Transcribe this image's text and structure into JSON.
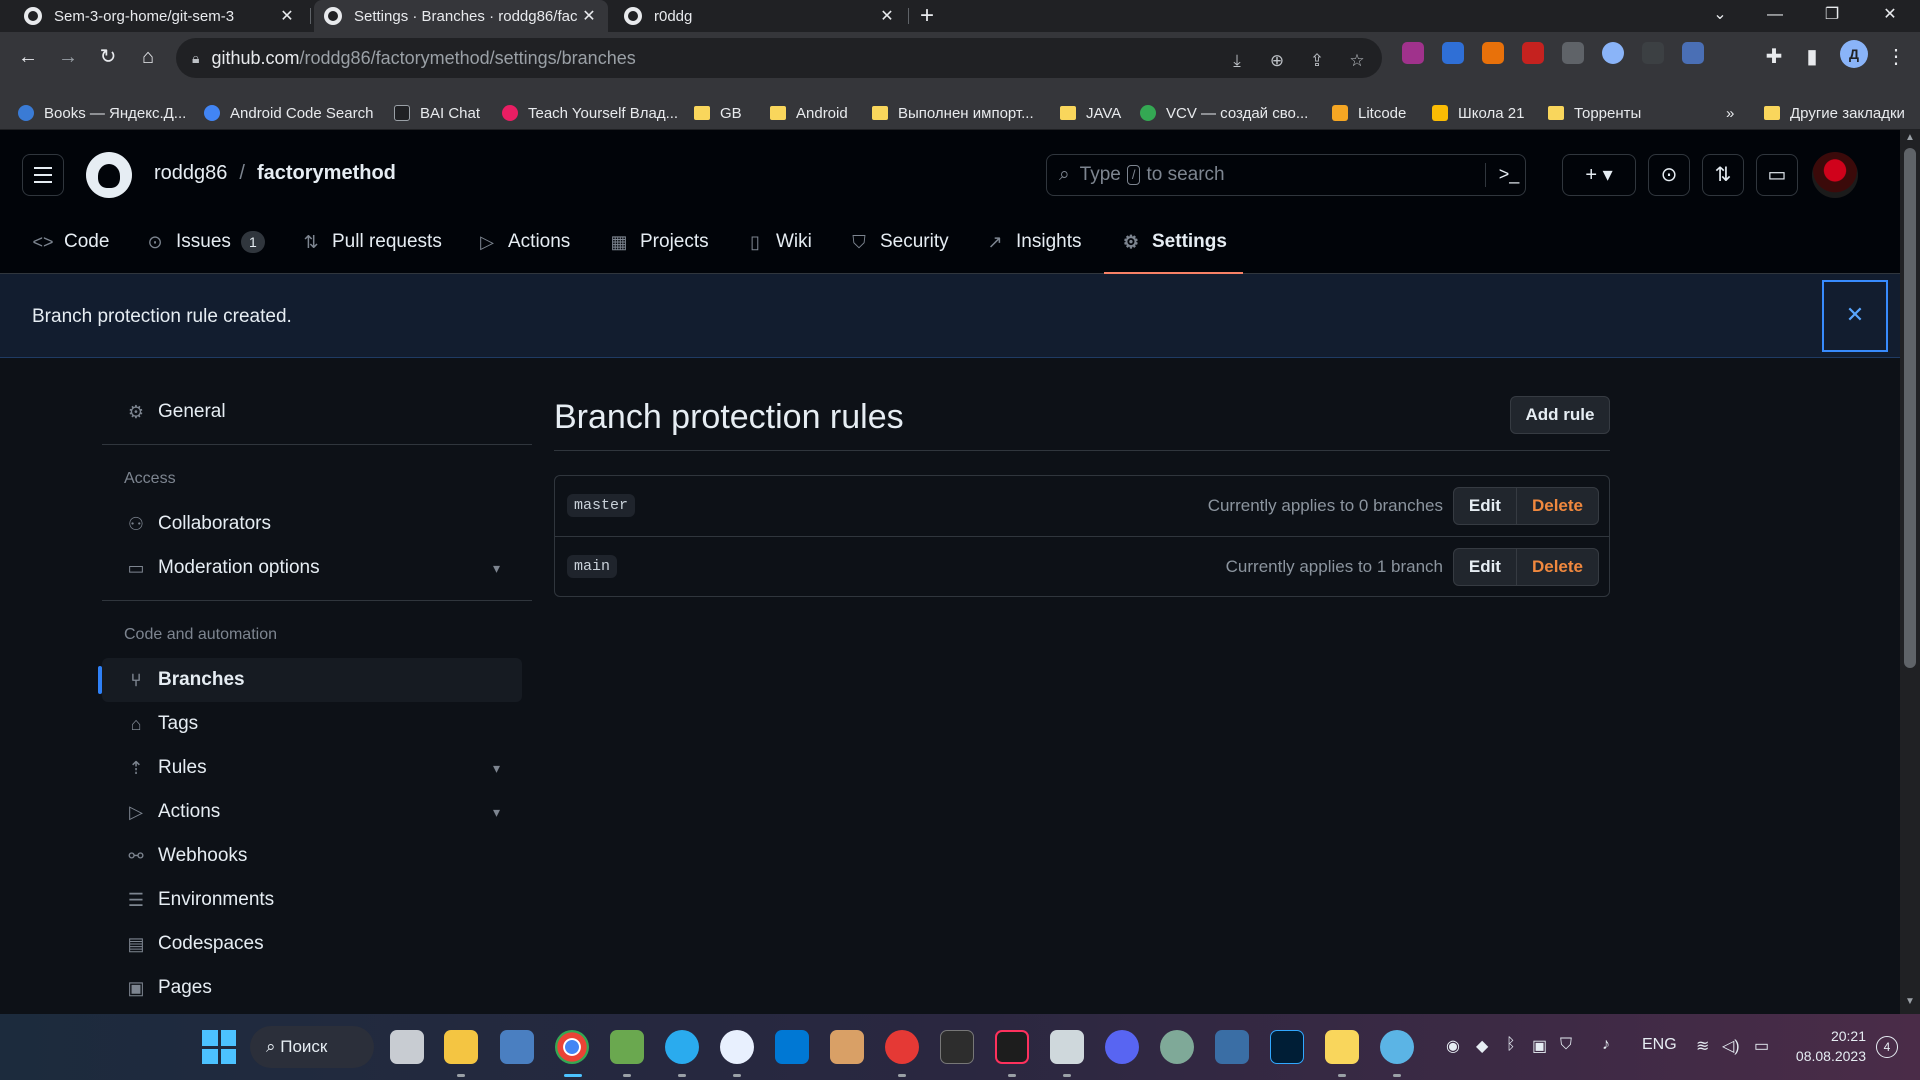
{
  "browser": {
    "tabs": [
      {
        "title": "Sem-3-org-home/git-sem-3",
        "close": "✕"
      },
      {
        "title": "Settings · Branches · roddg86/fac",
        "close": "✕"
      },
      {
        "title": "r0ddg",
        "close": "✕"
      }
    ],
    "new_tab": "+",
    "url_host": "github.com",
    "url_path": "/roddg86/factorymethod/settings/branches",
    "profile_initial": "Д",
    "bookmarks": [
      "Books — Яндекс.Д...",
      "Android Code Search",
      "BAI Chat",
      "Teach Yourself Влад...",
      "GB",
      "Android",
      "Выполнен импорт...",
      "JAVA",
      "VCV — создай сво...",
      "Litcode",
      "Школа 21",
      "Торренты"
    ],
    "bookmarks_overflow": "»",
    "other_bookmarks": "Другие закладки"
  },
  "github": {
    "owner": "roddg86",
    "separator": "/",
    "repo": "factorymethod",
    "search_pre": "Type",
    "search_key": "/",
    "search_post": "to search",
    "repo_tabs": [
      {
        "label": "Code"
      },
      {
        "label": "Issues",
        "count": "1"
      },
      {
        "label": "Pull requests"
      },
      {
        "label": "Actions"
      },
      {
        "label": "Projects"
      },
      {
        "label": "Wiki"
      },
      {
        "label": "Security"
      },
      {
        "label": "Insights"
      },
      {
        "label": "Settings"
      }
    ]
  },
  "flash": {
    "message": "Branch protection rule created.",
    "close": "✕"
  },
  "sidebar": {
    "general": "General",
    "access_heading": "Access",
    "collaborators": "Collaborators",
    "moderation": "Moderation options",
    "code_heading": "Code and automation",
    "branches": "Branches",
    "tags": "Tags",
    "rules": "Rules",
    "actions": "Actions",
    "webhooks": "Webhooks",
    "environments": "Environments",
    "codespaces": "Codespaces",
    "pages": "Pages"
  },
  "main": {
    "title": "Branch protection rules",
    "add_rule": "Add rule",
    "rules": [
      {
        "pattern": "master",
        "applies": "Currently applies to 0 branches",
        "edit": "Edit",
        "delete": "Delete"
      },
      {
        "pattern": "main",
        "applies": "Currently applies to 1 branch",
        "edit": "Edit",
        "delete": "Delete"
      }
    ]
  },
  "taskbar": {
    "search": "Поиск",
    "lang": "ENG",
    "time": "20:21",
    "date": "08.08.2023",
    "notifications": "4"
  },
  "colors": {
    "accent_tab_underline": "#f78166",
    "active_sidebar_indicator": "#2f81f7",
    "delete_text": "#f0883e"
  }
}
